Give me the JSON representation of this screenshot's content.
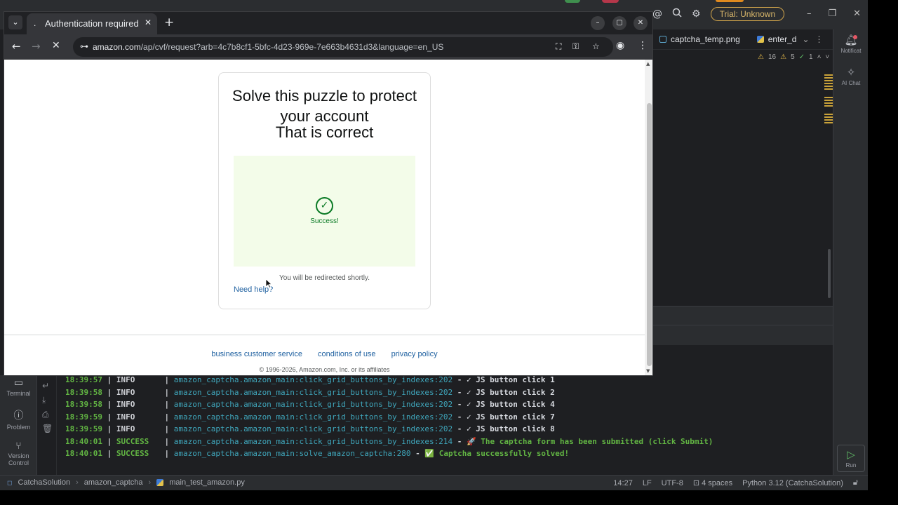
{
  "browser": {
    "tab_title": "Authentication required",
    "tab_favicon": ".",
    "url_host": "amazon.com",
    "url_path": "/ap/cvf/request?arb=4c7b8cf1-5bfc-4d23-969e-7e663b4631d3&language=en_US"
  },
  "page": {
    "title": "Solve this puzzle to protect your account",
    "subtitle": "That is correct",
    "success_label": "Success!",
    "redirect_text": "You will be redirected shortly.",
    "help_link": "Need help?",
    "footer_links": [
      "business customer service",
      "conditions of use",
      "privacy policy"
    ],
    "copyright": "© 1996-2026, Amazon.com, Inc. or its affiliates"
  },
  "ide": {
    "trial_badge": "Trial: Unknown",
    "tabs": [
      "captcha_temp.png",
      "enter_d"
    ],
    "inspections": {
      "warnings": "16",
      "weak_warnings": "5",
      "ok": "1"
    },
    "right_bar": {
      "notifications": "Notificat",
      "ai_chat": "AI Chat",
      "run": "Run"
    },
    "left_bar": {
      "terminal": "Terminal",
      "problems": "Problem",
      "version_control": "Version Control"
    },
    "console_lines": [
      {
        "time": "18:39:57",
        "level": "INFO",
        "source": "amazon_captcha.amazon_main:click_grid_buttons_by_indexes:202",
        "message": "✓ JS button click 1",
        "status": "info"
      },
      {
        "time": "18:39:58",
        "level": "INFO",
        "source": "amazon_captcha.amazon_main:click_grid_buttons_by_indexes:202",
        "message": "✓ JS button click 2",
        "status": "info"
      },
      {
        "time": "18:39:58",
        "level": "INFO",
        "source": "amazon_captcha.amazon_main:click_grid_buttons_by_indexes:202",
        "message": "✓ JS button click 4",
        "status": "info"
      },
      {
        "time": "18:39:59",
        "level": "INFO",
        "source": "amazon_captcha.amazon_main:click_grid_buttons_by_indexes:202",
        "message": "✓ JS button click 7",
        "status": "info"
      },
      {
        "time": "18:39:59",
        "level": "INFO",
        "source": "amazon_captcha.amazon_main:click_grid_buttons_by_indexes:202",
        "message": "✓ JS button click 8",
        "status": "info"
      },
      {
        "time": "18:40:01",
        "level": "SUCCESS",
        "source": "amazon_captcha.amazon_main:click_grid_buttons_by_indexes:214",
        "message": "🚀 The captcha form has been submitted (click Submit)",
        "status": "success"
      },
      {
        "time": "18:40:01",
        "level": "SUCCESS",
        "source": "amazon_captcha.amazon_main:solve_amazon_captcha:280",
        "message": "✅ Captcha successfully solved!",
        "status": "success"
      }
    ],
    "breadcrumb": [
      "CatchaSolution",
      "amazon_captcha",
      "main_test_amazon.py"
    ],
    "status": {
      "position": "14:27",
      "line_sep": "LF",
      "encoding": "UTF-8",
      "indent": "4 spaces",
      "interpreter": "Python 3.12 (CatchaSolution)"
    }
  },
  "colors": {
    "success_green": "#0a7a25",
    "link_blue": "#2162a1",
    "success_bg": "#f3fce9",
    "log_green": "#62b543",
    "log_cyan": "#3fa6bb"
  }
}
